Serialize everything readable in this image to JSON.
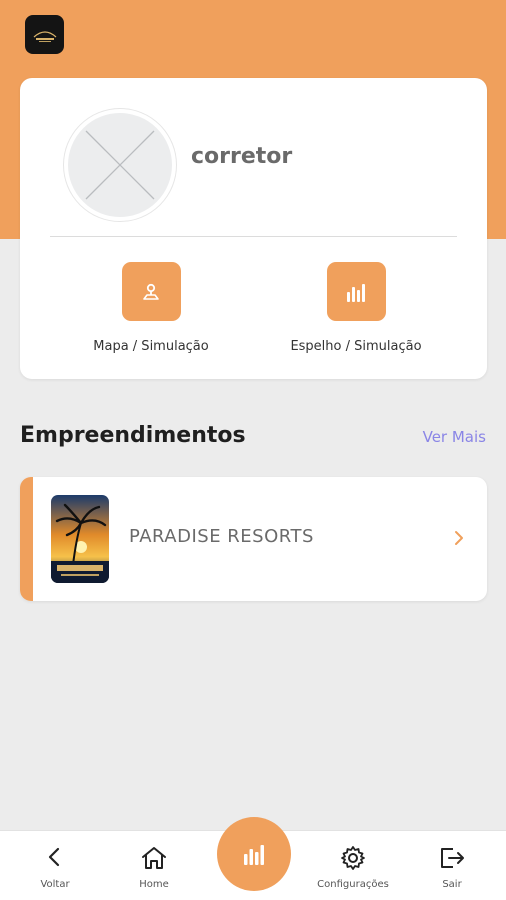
{
  "header": {
    "logo_icon": "paradise-logo-icon"
  },
  "profile": {
    "name": "corretor",
    "avatar_icon": "avatar-placeholder-icon",
    "actions": [
      {
        "label": "Mapa / Simulação",
        "icon": "map-pin-icon"
      },
      {
        "label": "Espelho / Simulação",
        "icon": "bar-chart-icon"
      }
    ]
  },
  "developments": {
    "title": "Empreendimentos",
    "see_more": "Ver Mais",
    "items": [
      {
        "name": "PARADISE RESORTS",
        "thumb_icon": "paradise-resorts-thumbnail"
      }
    ]
  },
  "bottom_nav": {
    "items": [
      {
        "label": "Voltar",
        "icon": "chevron-left-icon"
      },
      {
        "label": "Home",
        "icon": "home-icon"
      },
      {
        "label": "",
        "icon": "bar-chart-icon"
      },
      {
        "label": "Configurações",
        "icon": "gear-icon"
      },
      {
        "label": "Sair",
        "icon": "logout-icon"
      }
    ]
  },
  "colors": {
    "accent": "#f0a05c",
    "link": "#8a85e6",
    "background": "#ececec"
  }
}
